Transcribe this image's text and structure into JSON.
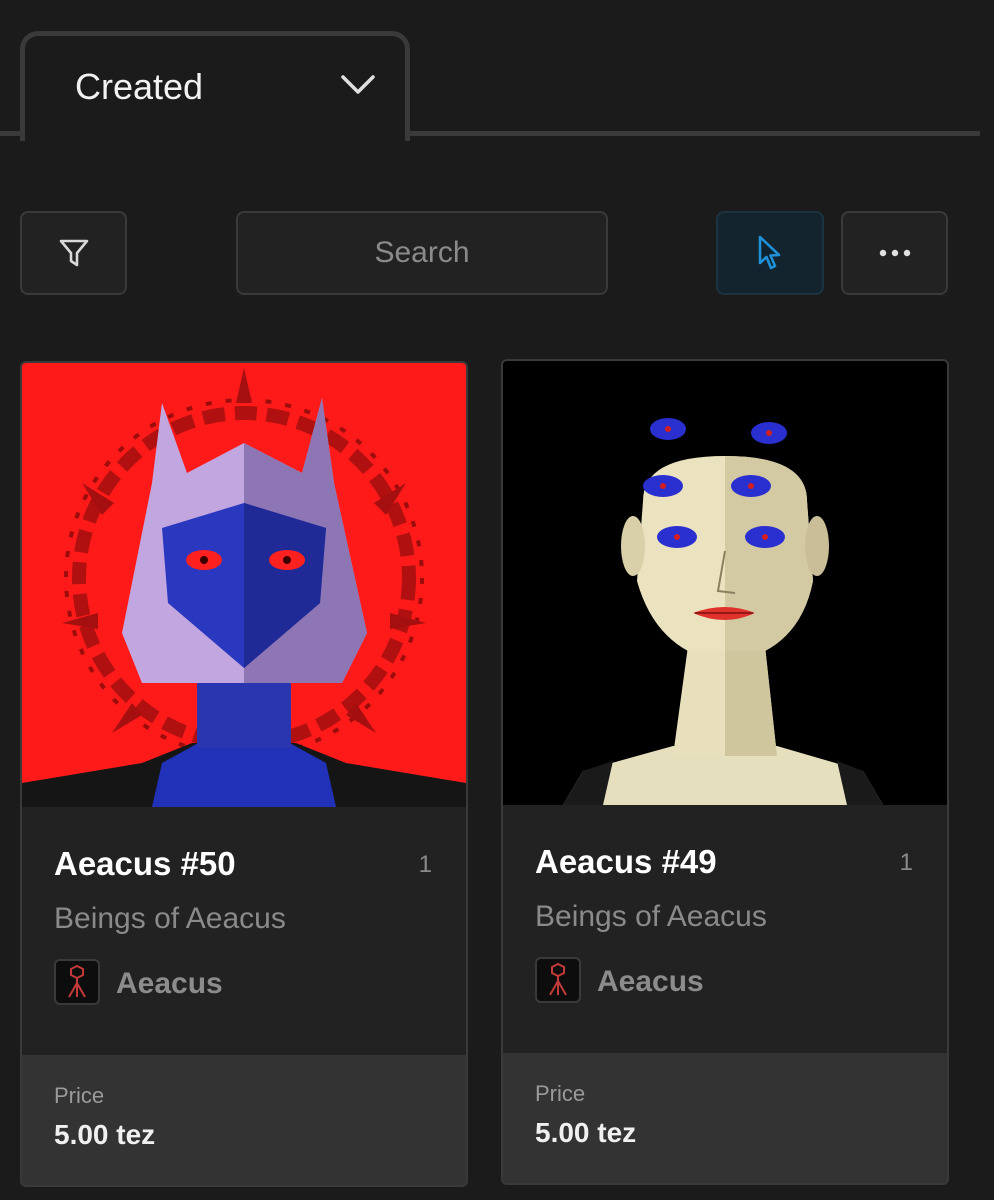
{
  "tab": {
    "label": "Created"
  },
  "toolbar": {
    "search_placeholder": "Search",
    "accent_color": "#1f8fd6"
  },
  "cards": [
    {
      "title": "Aeacus #50",
      "count": "1",
      "collection": "Beings of Aeacus",
      "creator": "Aeacus",
      "price_label": "Price",
      "price": "5.00 tez",
      "image_bg": "#ff1a1a"
    },
    {
      "title": "Aeacus #49",
      "count": "1",
      "collection": "Beings of Aeacus",
      "creator": "Aeacus",
      "price_label": "Price",
      "price": "5.00 tez",
      "image_bg": "#000000"
    }
  ]
}
